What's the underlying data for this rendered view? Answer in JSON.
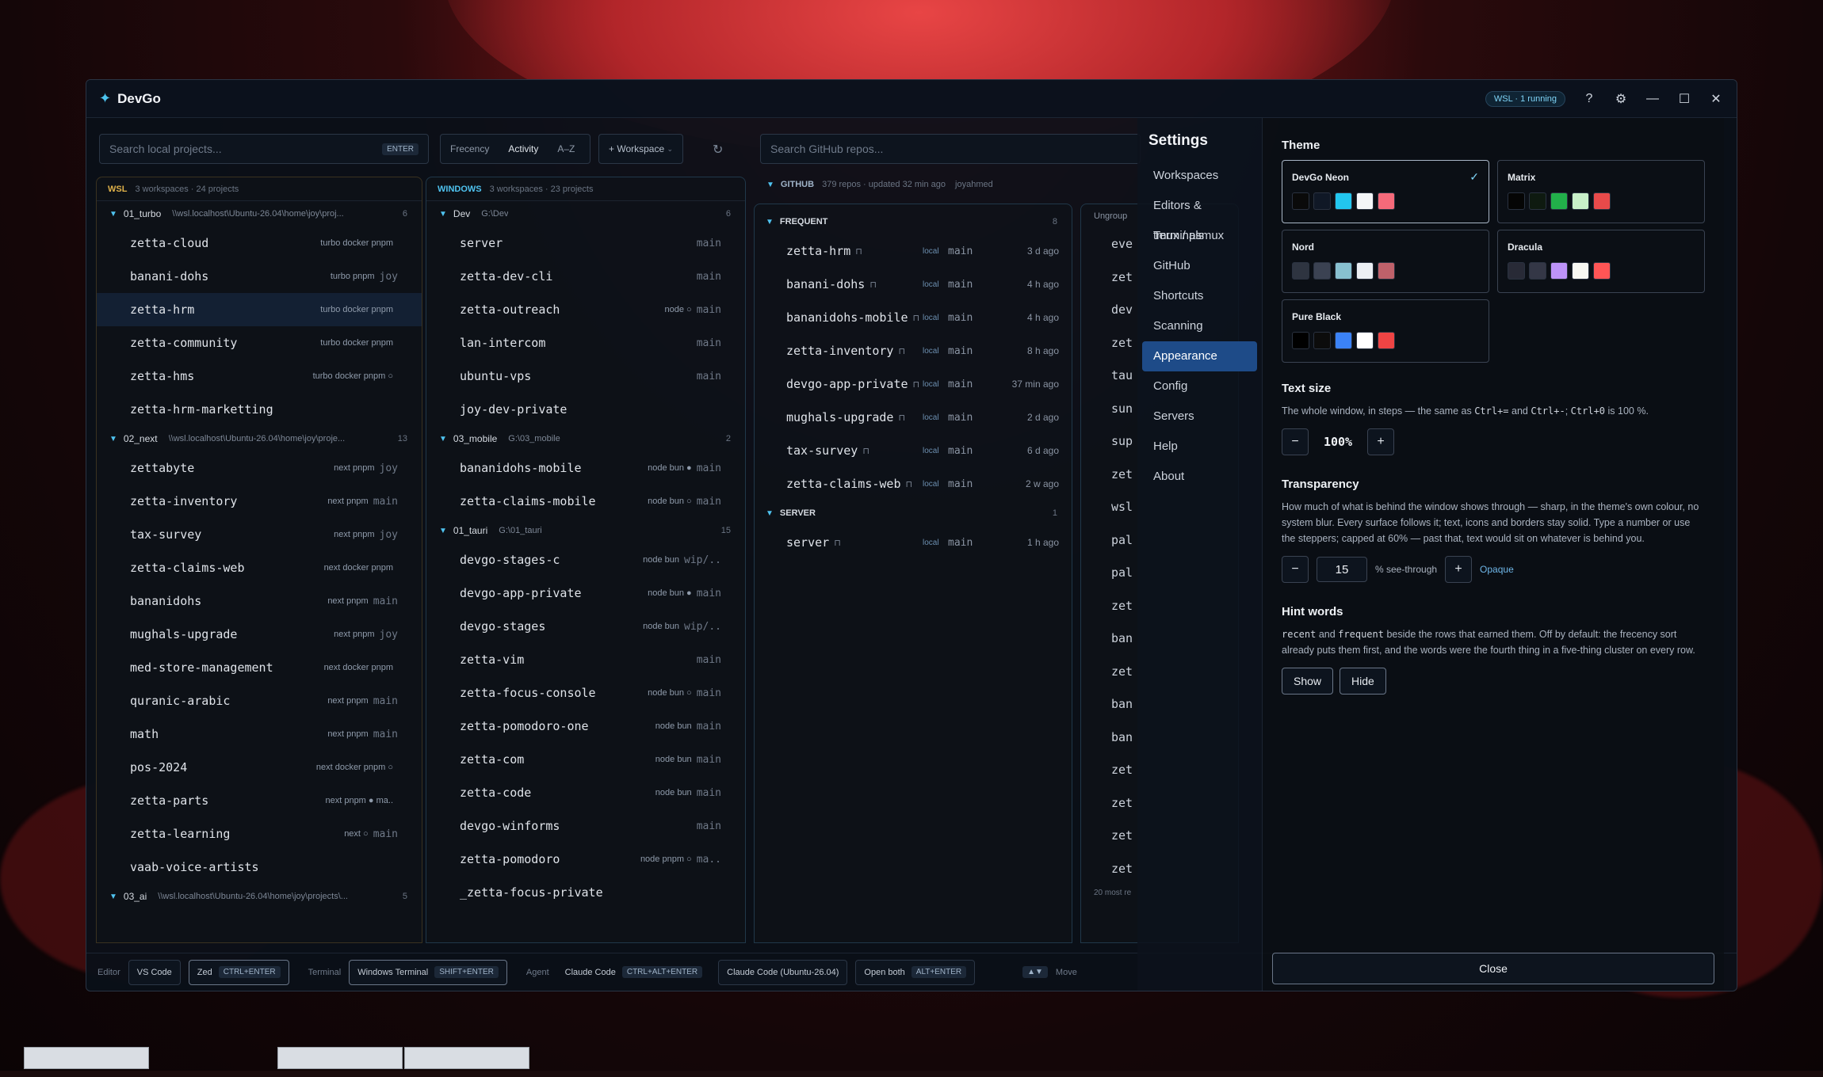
{
  "window": {
    "title": "DevGo",
    "wsl_status": "WSL · 1 running"
  },
  "toolbar": {
    "local_search_placeholder": "Search local projects...",
    "local_search_key": "ENTER",
    "sort_options": [
      "Frecency",
      "Activity",
      "A–Z"
    ],
    "workspace_button": "+ Workspace",
    "github_search_placeholder": "Search GitHub repos..."
  },
  "wsl_panel": {
    "tag": "WSL",
    "summary": "3 workspaces · 24 projects",
    "groups": [
      {
        "name": "01_turbo",
        "path": "\\\\wsl.localhost\\Ubuntu-26.04\\home\\joy\\proj...",
        "count": "6",
        "projects": [
          {
            "name": "zetta-cloud",
            "tags": "turbo docker pnpm",
            "branch": ""
          },
          {
            "name": "banani-dohs",
            "tags": "turbo pnpm",
            "branch": "joy"
          },
          {
            "name": "zetta-hrm",
            "tags": "turbo docker pnpm",
            "branch": ""
          },
          {
            "name": "zetta-community",
            "tags": "turbo docker pnpm",
            "branch": ""
          },
          {
            "name": "zetta-hms",
            "tags": "turbo docker pnpm ○",
            "branch": ""
          },
          {
            "name": "zetta-hrm-marketting",
            "tags": "",
            "branch": ""
          }
        ]
      },
      {
        "name": "02_next",
        "path": "\\\\wsl.localhost\\Ubuntu-26.04\\home\\joy\\proje...",
        "count": "13",
        "projects": [
          {
            "name": "zettabyte",
            "tags": "next pnpm",
            "branch": "joy"
          },
          {
            "name": "zetta-inventory",
            "tags": "next pnpm",
            "branch": "main"
          },
          {
            "name": "tax-survey",
            "tags": "next pnpm",
            "branch": "joy"
          },
          {
            "name": "zetta-claims-web",
            "tags": "next docker pnpm",
            "branch": ""
          },
          {
            "name": "bananidohs",
            "tags": "next pnpm",
            "branch": "main"
          },
          {
            "name": "mughals-upgrade",
            "tags": "next pnpm",
            "branch": "joy"
          },
          {
            "name": "med-store-management",
            "tags": "next docker pnpm",
            "branch": ""
          },
          {
            "name": "quranic-arabic",
            "tags": "next pnpm",
            "branch": "main"
          },
          {
            "name": "math",
            "tags": "next pnpm",
            "branch": "main"
          },
          {
            "name": "pos-2024",
            "tags": "next docker pnpm ○",
            "branch": ""
          },
          {
            "name": "zetta-parts",
            "tags": "next pnpm ● ma..",
            "branch": ""
          },
          {
            "name": "zetta-learning",
            "tags": "next ○",
            "branch": "main"
          },
          {
            "name": "vaab-voice-artists",
            "tags": "",
            "branch": ""
          }
        ]
      },
      {
        "name": "03_ai",
        "path": "\\\\wsl.localhost\\Ubuntu-26.04\\home\\joy\\projects\\...",
        "count": "5",
        "projects": []
      }
    ]
  },
  "windows_panel": {
    "tag": "WINDOWS",
    "summary": "3 workspaces · 23 projects",
    "groups": [
      {
        "name": "Dev",
        "path": "G:\\Dev",
        "count": "6",
        "projects": [
          {
            "name": "server",
            "tags": "",
            "branch": "main"
          },
          {
            "name": "zetta-dev-cli",
            "tags": "",
            "branch": "main"
          },
          {
            "name": "zetta-outreach",
            "tags": "node ○",
            "branch": "main"
          },
          {
            "name": "lan-intercom",
            "tags": "",
            "branch": "main"
          },
          {
            "name": "ubuntu-vps",
            "tags": "",
            "branch": "main"
          },
          {
            "name": "joy-dev-private",
            "tags": "",
            "branch": ""
          }
        ]
      },
      {
        "name": "03_mobile",
        "path": "G:\\03_mobile",
        "count": "2",
        "projects": [
          {
            "name": "bananidohs-mobile",
            "tags": "node bun ●",
            "branch": "main"
          },
          {
            "name": "zetta-claims-mobile",
            "tags": "node bun ○",
            "branch": "main"
          }
        ]
      },
      {
        "name": "01_tauri",
        "path": "G:\\01_tauri",
        "count": "15",
        "projects": [
          {
            "name": "devgo-stages-c",
            "tags": "node bun",
            "branch": "wip/.."
          },
          {
            "name": "devgo-app-private",
            "tags": "node bun ●",
            "branch": "main"
          },
          {
            "name": "devgo-stages",
            "tags": "node bun",
            "branch": "wip/.."
          },
          {
            "name": "zetta-vim",
            "tags": "",
            "branch": "main"
          },
          {
            "name": "zetta-focus-console",
            "tags": "node bun ○",
            "branch": "main"
          },
          {
            "name": "zetta-pomodoro-one",
            "tags": "node bun",
            "branch": "main"
          },
          {
            "name": "zetta-com",
            "tags": "node bun",
            "branch": "main"
          },
          {
            "name": "zetta-code",
            "tags": "node bun",
            "branch": "main"
          },
          {
            "name": "devgo-winforms",
            "tags": "",
            "branch": "main"
          },
          {
            "name": "zetta-pomodoro",
            "tags": "node pnpm ○",
            "branch": "ma.."
          },
          {
            "name": "_zetta-focus-private",
            "tags": "",
            "branch": ""
          }
        ]
      }
    ]
  },
  "github_panel": {
    "tag": "GITHUB",
    "summary": "379 repos · updated 32 min ago",
    "user": "joyahmed",
    "sections": [
      {
        "name": "FREQUENT",
        "count": "8",
        "repos": [
          {
            "name": "zetta-hrm",
            "local": "local",
            "branch": "main",
            "ago": "3 d ago"
          },
          {
            "name": "banani-dohs",
            "local": "local",
            "branch": "main",
            "ago": "4 h ago"
          },
          {
            "name": "bananidohs-mobile",
            "local": "local",
            "branch": "main",
            "ago": "4 h ago"
          },
          {
            "name": "zetta-inventory",
            "local": "local",
            "branch": "main",
            "ago": "8 h ago"
          },
          {
            "name": "devgo-app-private",
            "local": "local",
            "branch": "main",
            "ago": "37 min ago"
          },
          {
            "name": "mughals-upgrade",
            "local": "local",
            "branch": "main",
            "ago": "2 d ago"
          },
          {
            "name": "tax-survey",
            "local": "local",
            "branch": "main",
            "ago": "6 d ago"
          },
          {
            "name": "zetta-claims-web",
            "local": "local",
            "branch": "main",
            "ago": "2 w ago"
          }
        ]
      },
      {
        "name": "SERVER",
        "count": "1",
        "repos": [
          {
            "name": "server",
            "local": "local",
            "branch": "main",
            "ago": "1 h ago"
          }
        ]
      }
    ],
    "ungrouped_label": "Ungroup",
    "ungrouped_items": [
      "eve",
      "zet",
      "dev",
      "zet",
      "tau",
      "sun",
      "sup",
      "zet",
      "wsl",
      "pal",
      "pal",
      "zet",
      "ban",
      "zet",
      "ban",
      "ban",
      "zet",
      "zet",
      "zet",
      "zet"
    ],
    "ungrouped_footer": "20 most re"
  },
  "bottombar": {
    "editor_label": "Editor",
    "editor_vscode": "VS Code",
    "editor_zed": "Zed",
    "editor_zed_key": "CTRL+ENTER",
    "terminal_label": "Terminal",
    "terminal_name": "Windows Terminal",
    "terminal_key": "SHIFT+ENTER",
    "agent_label": "Agent",
    "agent_name": "Claude Code",
    "agent_key": "CTRL+ALT+ENTER",
    "agent_alt": "Claude Code (Ubuntu-26.04)",
    "open_both": "Open both",
    "open_both_key": "ALT+ENTER",
    "move_key": "▲▼",
    "move_label": "Move"
  },
  "settings": {
    "title": "Settings",
    "nav": [
      "Workspaces",
      "Editors & Terminals",
      "tmux / psmux",
      "GitHub",
      "Shortcuts",
      "Scanning",
      "Appearance",
      "Config",
      "Servers",
      "Help",
      "About"
    ],
    "active_nav": "Appearance",
    "theme_heading": "Theme",
    "themes": [
      {
        "name": "DevGo Neon",
        "selected": true,
        "colors": [
          "#0a0a0a",
          "#101826",
          "#22c6ee",
          "#f4f6f8",
          "#f56a7a"
        ]
      },
      {
        "name": "Matrix",
        "selected": false,
        "colors": [
          "#050505",
          "#0e1a10",
          "#22b04a",
          "#c8f0c8",
          "#e84a4a"
        ]
      },
      {
        "name": "Nord",
        "selected": false,
        "colors": [
          "#2e3440",
          "#3b4252",
          "#88c0d0",
          "#eceff4",
          "#bf616a"
        ]
      },
      {
        "name": "Dracula",
        "selected": false,
        "colors": [
          "#282a36",
          "#343746",
          "#bd93f9",
          "#f8f8f2",
          "#ff5555"
        ]
      },
      {
        "name": "Pure Black",
        "selected": false,
        "colors": [
          "#000000",
          "#0c0c0c",
          "#3b82f6",
          "#ffffff",
          "#ef4444"
        ]
      }
    ],
    "text_size": {
      "heading": "Text size",
      "desc_before": "The whole window, in steps — the same as ",
      "k1": "Ctrl+=",
      "and": " and ",
      "k2": "Ctrl+-",
      "sep": "; ",
      "k3": "Ctrl+0",
      "desc_after": " is 100 %.",
      "value": "100%",
      "minus": "−",
      "plus": "+"
    },
    "transparency": {
      "heading": "Transparency",
      "desc": "How much of what is behind the window shows through — sharp, in the theme's own colour, no system blur. Every surface follows it; text, icons and borders stay solid. Type a number or use the steppers; capped at 60% — past that, text would sit on whatever is behind you.",
      "value": "15",
      "unit_label": "% see-through",
      "opaque_link": "Opaque",
      "minus": "−",
      "plus": "+"
    },
    "hint_words": {
      "heading": "Hint words",
      "w1": "recent",
      "and": " and ",
      "w2": "frequent",
      "desc": " beside the rows that earned them. Off by default: the frecency sort already puts them first, and the words were the fourth thing in a five-thing cluster on every row.",
      "show": "Show",
      "hide": "Hide"
    },
    "close": "Close"
  }
}
